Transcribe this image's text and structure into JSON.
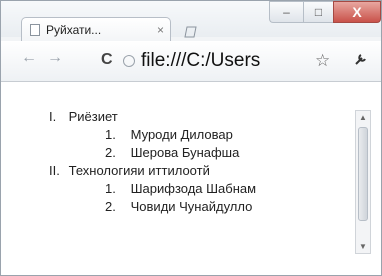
{
  "tab": {
    "title": "Руйхати...",
    "close": "×"
  },
  "toolbar": {
    "back": "←",
    "forward": "→",
    "reload": "C",
    "url": "file:///C:/Users",
    "star": "☆",
    "wrench": "🔧"
  },
  "window_controls": {
    "minimize": "–",
    "maximize": "□",
    "close": "X"
  },
  "list": [
    {
      "marker": "I.",
      "label": "Риёзиет",
      "children": [
        {
          "marker": "1.",
          "label": "Муроди Диловар"
        },
        {
          "marker": "2.",
          "label": "Шерова Бунафша"
        }
      ]
    },
    {
      "marker": "II.",
      "label": "Технологияи иттилоотй",
      "children": [
        {
          "marker": "1.",
          "label": "Шарифзода Шабнам"
        },
        {
          "marker": "2.",
          "label": "Човиди Чунайдулло"
        }
      ]
    }
  ]
}
